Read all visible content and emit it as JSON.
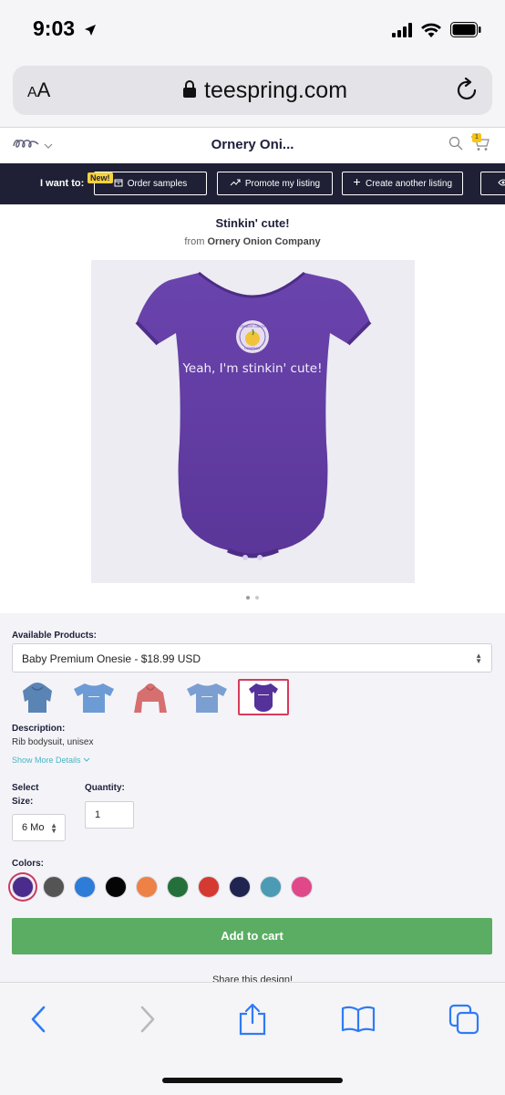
{
  "status": {
    "time": "9:03"
  },
  "browser": {
    "aa_small": "A",
    "aa_large": "A",
    "url": "teespring.com"
  },
  "site": {
    "title": "Ornery Oni...",
    "cart_count": "1"
  },
  "owner_toolbar": {
    "label": "I want to:",
    "new_badge": "New!",
    "buttons": [
      {
        "label": "Order samples"
      },
      {
        "label": "Promote my listing"
      },
      {
        "label": "Create another listing"
      }
    ]
  },
  "product": {
    "title": "Stinkin' cute!",
    "from_prefix": "from",
    "store_name": "Ornery Onion Company",
    "shirt_text": "Yeah, I'm stinkin' cute!",
    "logo_text_top": "ORNERY ONION",
    "logo_text_bottom": "COMPANY",
    "available_label": "Available Products:",
    "selected_product": "Baby Premium Onesie - $18.99 USD",
    "thumbnails": [
      {
        "name": "Hoodie",
        "color": "#5a84b4"
      },
      {
        "name": "T-shirt",
        "color": "#6d9bd6"
      },
      {
        "name": "Hoodie",
        "color": "#d66f70"
      },
      {
        "name": "T-shirt",
        "color": "#7c9fd2"
      },
      {
        "name": "Baby Onesie",
        "color": "#55319a"
      }
    ],
    "description_label": "Description:",
    "description": "Rib bodysuit, unisex",
    "show_more": "Show More Details",
    "size_label_1": "Select",
    "size_label_2": "Size:",
    "size_value": "6 Mo",
    "quantity_label": "Quantity:",
    "quantity_value": "1",
    "colors_label": "Colors:",
    "colors": [
      "#4b2b8c",
      "#545454",
      "#2d7cd8",
      "#050505",
      "#ee8146",
      "#24703a",
      "#d53a32",
      "#1f2450",
      "#4a9bb3",
      "#e0488a"
    ],
    "add_to_cart": "Add to cart",
    "share": "Share this design!"
  }
}
